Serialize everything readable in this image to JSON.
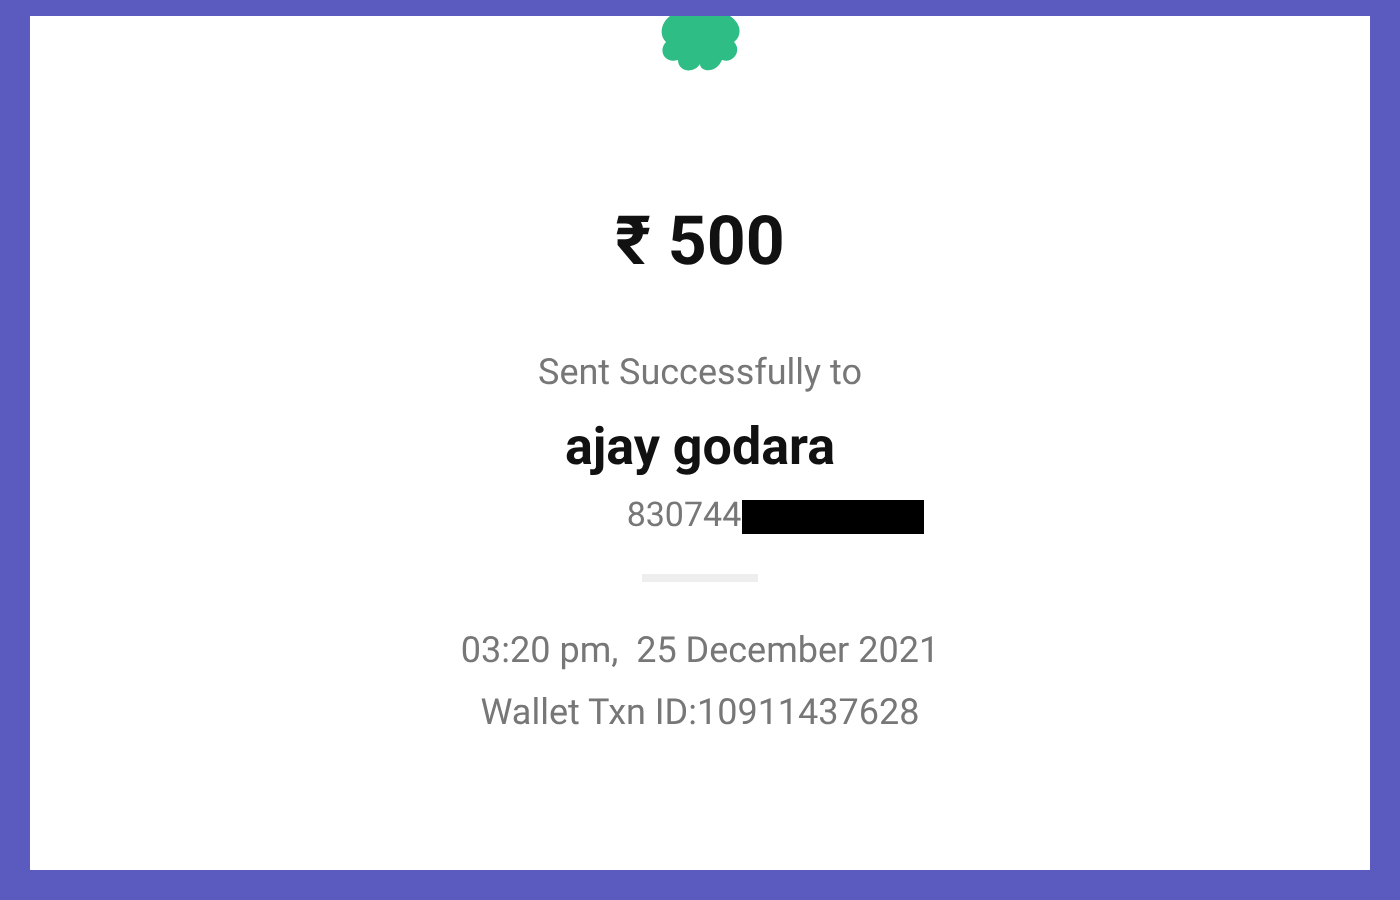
{
  "amount": "₹ 500",
  "status": "Sent Successfully to",
  "recipient": {
    "name": "ajay godara",
    "phone": "830744"
  },
  "datetime": "03:20 pm,  25 December 2021",
  "transaction_id": "Wallet Txn ID:10911437628"
}
